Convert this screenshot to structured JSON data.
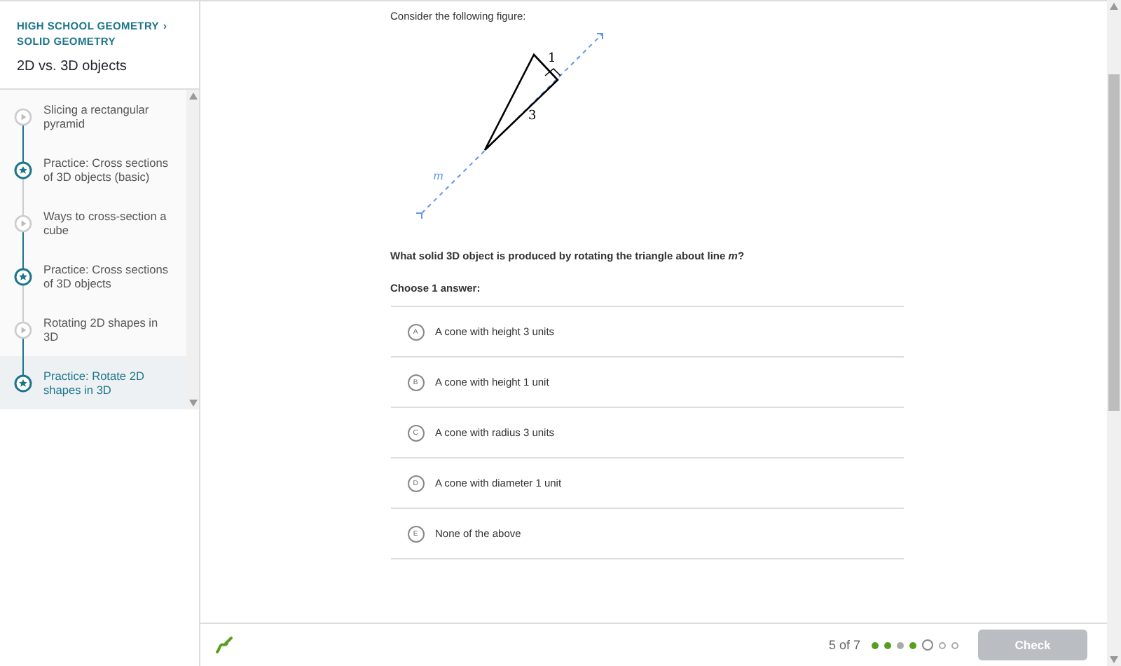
{
  "sidebar": {
    "breadcrumb": [
      "HIGH SCHOOL GEOMETRY",
      "SOLID GEOMETRY"
    ],
    "breadcrumb_separator": "›",
    "title": "2D vs. 3D objects",
    "items": [
      {
        "kind": "video",
        "label": "Slicing a rectangular pyramid",
        "selected": false
      },
      {
        "kind": "practice",
        "label": "Practice: Cross sections of 3D objects (basic)",
        "selected": false
      },
      {
        "kind": "video",
        "label": "Ways to cross-section a cube",
        "selected": false
      },
      {
        "kind": "practice",
        "label": "Practice: Cross sections of 3D objects",
        "selected": false
      },
      {
        "kind": "video",
        "label": "Rotating 2D shapes in 3D",
        "selected": false
      },
      {
        "kind": "practice",
        "label": "Practice: Rotate 2D shapes in 3D",
        "selected": true
      }
    ]
  },
  "question": {
    "intro": "Consider the following figure:",
    "figure": {
      "side_short": "1",
      "side_long": "3",
      "line_label": "m"
    },
    "prompt": "What solid 3D object is produced by rotating the triangle about line *m*?",
    "instruction": "Choose 1 answer:",
    "choices": [
      {
        "letter": "A",
        "text": "A cone with height 3 units",
        "selected": false
      },
      {
        "letter": "B",
        "text": "A cone with height 1 unit",
        "selected": false
      },
      {
        "letter": "C",
        "text": "A cone with radius 3 units",
        "selected": false
      },
      {
        "letter": "D",
        "text": "A cone with diameter 1 unit",
        "selected": false
      },
      {
        "letter": "E",
        "text": "None of the above",
        "selected": false
      }
    ]
  },
  "footer": {
    "progress": "5 of 7",
    "dots": [
      {
        "kind": "correct"
      },
      {
        "kind": "correct"
      },
      {
        "kind": "incorrect"
      },
      {
        "kind": "correct"
      },
      {
        "kind": "current"
      },
      {
        "kind": "upcoming"
      },
      {
        "kind": "upcoming"
      }
    ],
    "check": {
      "label": "Check",
      "disabled": true
    }
  }
}
